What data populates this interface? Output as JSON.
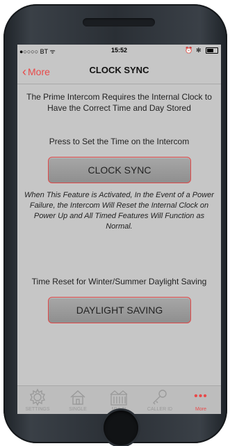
{
  "status_bar": {
    "carrier": "●○○○○ BT ᯤ",
    "time": "15:52",
    "indicators": "⏰ ✻"
  },
  "nav": {
    "back_label": "More",
    "title": "CLOCK SYNC"
  },
  "content": {
    "intro": "The Prime Intercom Requires the Internal Clock to Have the Correct Time and Day Stored",
    "press_label": "Press to Set the Time on the Intercom",
    "clock_sync_button": "CLOCK SYNC",
    "note": "When This Feature is Activated, In the Event of a Power Failure, the Intercom Will Reset the Internal Clock on Power Up and All Timed Features Will Function as Normal.",
    "dst_label": "Time Reset for Winter/Summer Daylight Saving",
    "daylight_button": "DAYLIGHT SAVING"
  },
  "tabs": [
    {
      "label": "SETTINGS",
      "icon": "gear-icon"
    },
    {
      "label": "SINGLE",
      "icon": "house-icon"
    },
    {
      "label": "MULTI",
      "icon": "building-icon"
    },
    {
      "label": "CALLER ID",
      "icon": "key-icon"
    },
    {
      "label": "More",
      "icon": "more-dots-icon",
      "active": true
    }
  ],
  "colors": {
    "accent": "#e84a4a",
    "screen_bg": "#c6c6c6",
    "button_bg": "#9b9b9b",
    "phone_body": "#2f353b"
  }
}
